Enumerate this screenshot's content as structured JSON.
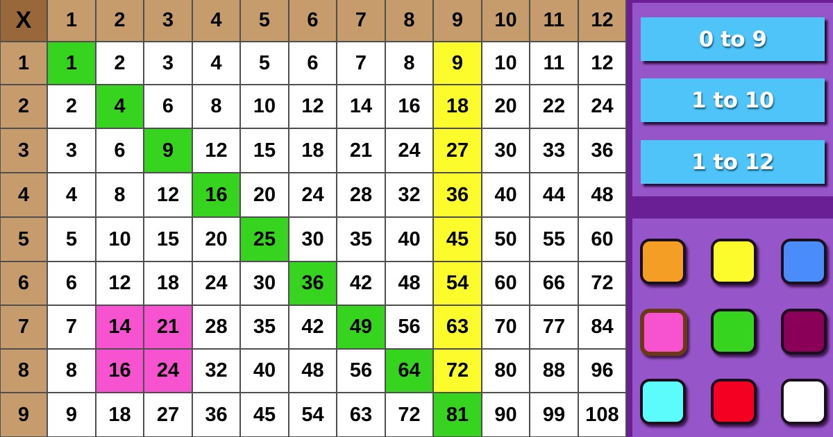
{
  "table": {
    "corner_label": "X",
    "column_headers": [
      "1",
      "2",
      "3",
      "4",
      "5",
      "6",
      "7",
      "8",
      "9",
      "10",
      "11",
      "12"
    ],
    "row_headers": [
      "1",
      "2",
      "3",
      "4",
      "5",
      "6",
      "7",
      "8",
      "9"
    ],
    "rows": [
      [
        "1",
        "2",
        "3",
        "4",
        "5",
        "6",
        "7",
        "8",
        "9",
        "10",
        "11",
        "12"
      ],
      [
        "2",
        "4",
        "6",
        "8",
        "10",
        "12",
        "14",
        "16",
        "18",
        "20",
        "22",
        "24"
      ],
      [
        "3",
        "6",
        "9",
        "12",
        "15",
        "18",
        "21",
        "24",
        "27",
        "30",
        "33",
        "36"
      ],
      [
        "4",
        "8",
        "12",
        "16",
        "20",
        "24",
        "28",
        "32",
        "36",
        "40",
        "44",
        "48"
      ],
      [
        "5",
        "10",
        "15",
        "20",
        "25",
        "30",
        "35",
        "40",
        "45",
        "50",
        "55",
        "60"
      ],
      [
        "6",
        "12",
        "18",
        "24",
        "30",
        "36",
        "42",
        "48",
        "54",
        "60",
        "66",
        "72"
      ],
      [
        "7",
        "14",
        "21",
        "28",
        "35",
        "42",
        "49",
        "56",
        "63",
        "70",
        "77",
        "84"
      ],
      [
        "8",
        "16",
        "24",
        "32",
        "40",
        "48",
        "56",
        "64",
        "72",
        "80",
        "88",
        "96"
      ],
      [
        "9",
        "18",
        "27",
        "36",
        "45",
        "54",
        "63",
        "72",
        "81",
        "90",
        "99",
        "108"
      ]
    ],
    "highlights": [
      {
        "color": "green",
        "cells": [
          [
            1,
            1
          ],
          [
            2,
            2
          ],
          [
            3,
            3
          ],
          [
            4,
            4
          ],
          [
            5,
            5
          ],
          [
            6,
            6
          ],
          [
            7,
            7
          ],
          [
            8,
            8
          ],
          [
            9,
            9
          ]
        ]
      },
      {
        "color": "yellow",
        "cells": [
          [
            1,
            9
          ],
          [
            2,
            9
          ],
          [
            3,
            9
          ],
          [
            4,
            9
          ],
          [
            5,
            9
          ],
          [
            6,
            9
          ],
          [
            7,
            9
          ],
          [
            8,
            9
          ]
        ]
      },
      {
        "color": "pink",
        "cells": [
          [
            7,
            2
          ],
          [
            7,
            3
          ],
          [
            8,
            2
          ],
          [
            8,
            3
          ]
        ]
      }
    ]
  },
  "colors": {
    "header": "#c69c6d",
    "corner": "#99683a",
    "green": "#36d41f",
    "yellow": "#fcfc2c",
    "pink": "#f752cf"
  },
  "range_buttons": [
    {
      "label": "0 to 9"
    },
    {
      "label": "1 to 10"
    },
    {
      "label": "1 to 12"
    }
  ],
  "palette": {
    "selected": "pink",
    "swatches": [
      {
        "name": "orange",
        "color": "#f49e26"
      },
      {
        "name": "yellow",
        "color": "#fcfc2c"
      },
      {
        "name": "blue",
        "color": "#4b8cfb"
      },
      {
        "name": "pink",
        "color": "#f752cf"
      },
      {
        "name": "green",
        "color": "#36d41f"
      },
      {
        "name": "purple",
        "color": "#8a0058"
      },
      {
        "name": "cyan",
        "color": "#5cfcfc"
      },
      {
        "name": "red",
        "color": "#f40022"
      },
      {
        "name": "white",
        "color": "#ffffff"
      }
    ]
  }
}
